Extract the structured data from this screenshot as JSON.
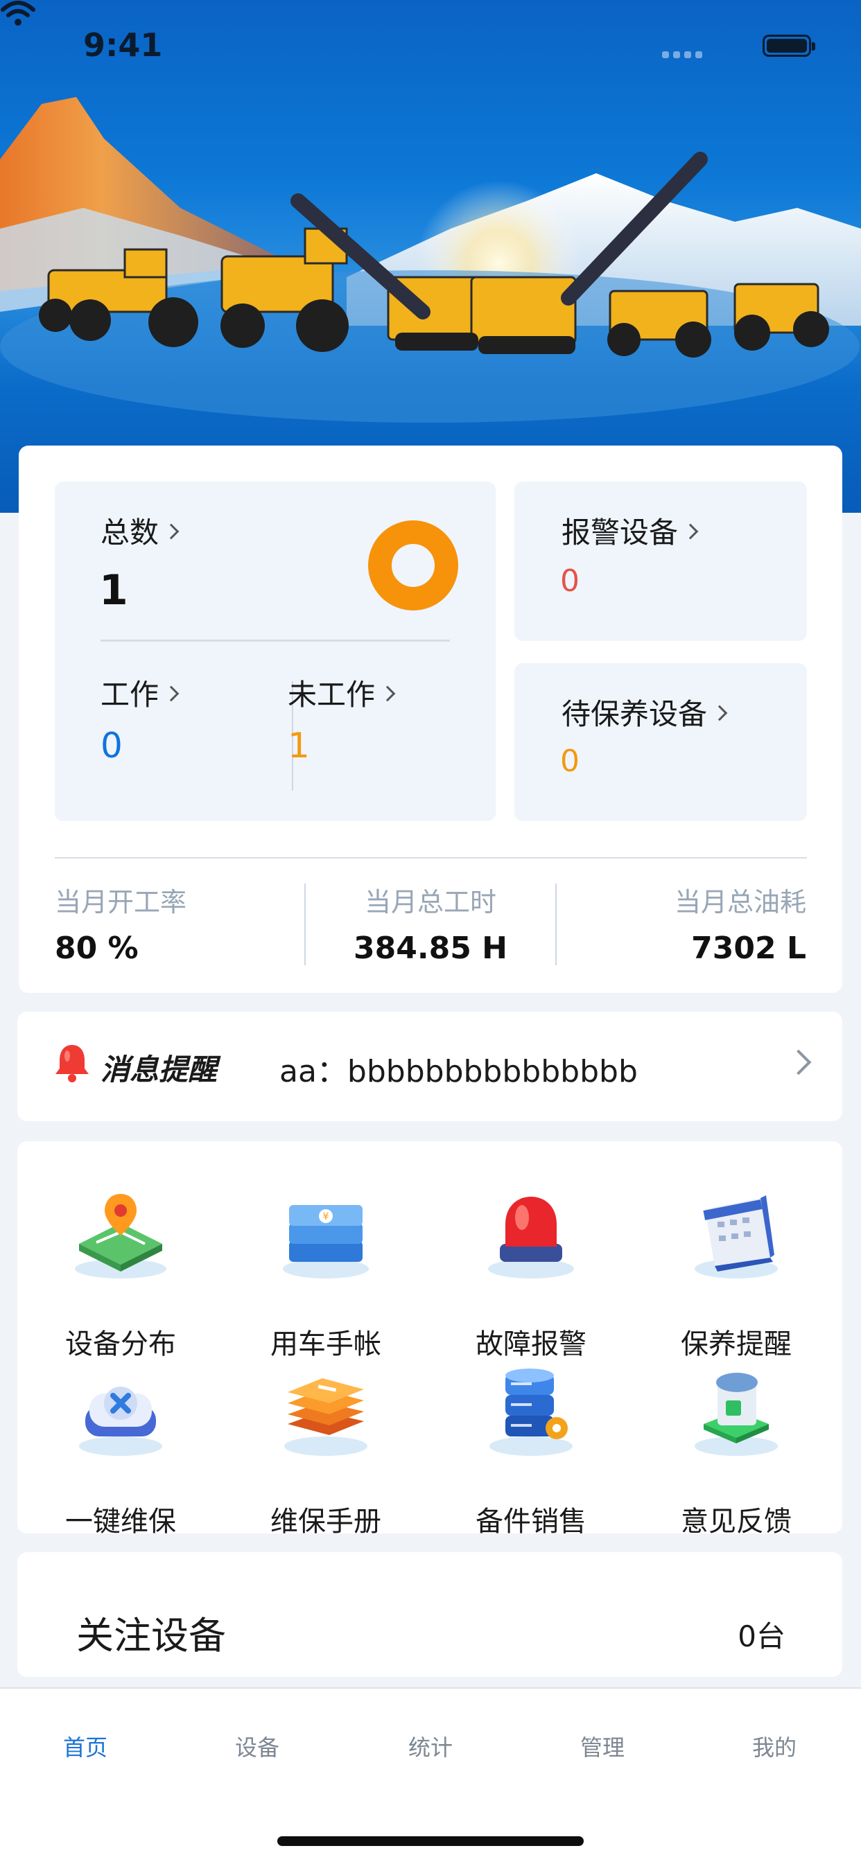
{
  "status_bar": {
    "time": "9:41"
  },
  "stats": {
    "total": {
      "label": "总数",
      "value": "1"
    },
    "working": {
      "label": "工作",
      "value": "0"
    },
    "idle": {
      "label": "未工作",
      "value": "1"
    },
    "alarm": {
      "label": "报警设备",
      "value": "0"
    },
    "maintenance": {
      "label": "待保养设备",
      "value": "0"
    },
    "metrics": [
      {
        "label": "当月开工率",
        "value": "80 %"
      },
      {
        "label": "当月总工时",
        "value": "384.85 H"
      },
      {
        "label": "当月总油耗",
        "value": "7302 L"
      }
    ]
  },
  "notice": {
    "title": "消息提醒",
    "text": "aa：bbbbbbbbbbbbbbb"
  },
  "grid": [
    {
      "label": "设备分布",
      "icon": "map-pin-icon"
    },
    {
      "label": "用车手帐",
      "icon": "books-icon"
    },
    {
      "label": "故障报警",
      "icon": "alarm-light-icon"
    },
    {
      "label": "保养提醒",
      "icon": "calendar-icon"
    },
    {
      "label": "一键维保",
      "icon": "repair-button-icon"
    },
    {
      "label": "维保手册",
      "icon": "manual-icon"
    },
    {
      "label": "备件销售",
      "icon": "parts-server-icon"
    },
    {
      "label": "意见反馈",
      "icon": "feedback-icon"
    }
  ],
  "follow": {
    "title": "关注设备",
    "count": "0台"
  },
  "tabs": [
    {
      "label": "首页",
      "active": true
    },
    {
      "label": "设备",
      "active": false
    },
    {
      "label": "统计",
      "active": false
    },
    {
      "label": "管理",
      "active": false
    },
    {
      "label": "我的",
      "active": false
    }
  ],
  "colors": {
    "primary": "#1273de",
    "orange": "#f39a10",
    "alarm_red": "#e5534b",
    "banner_blue": "#0b6cc9"
  }
}
